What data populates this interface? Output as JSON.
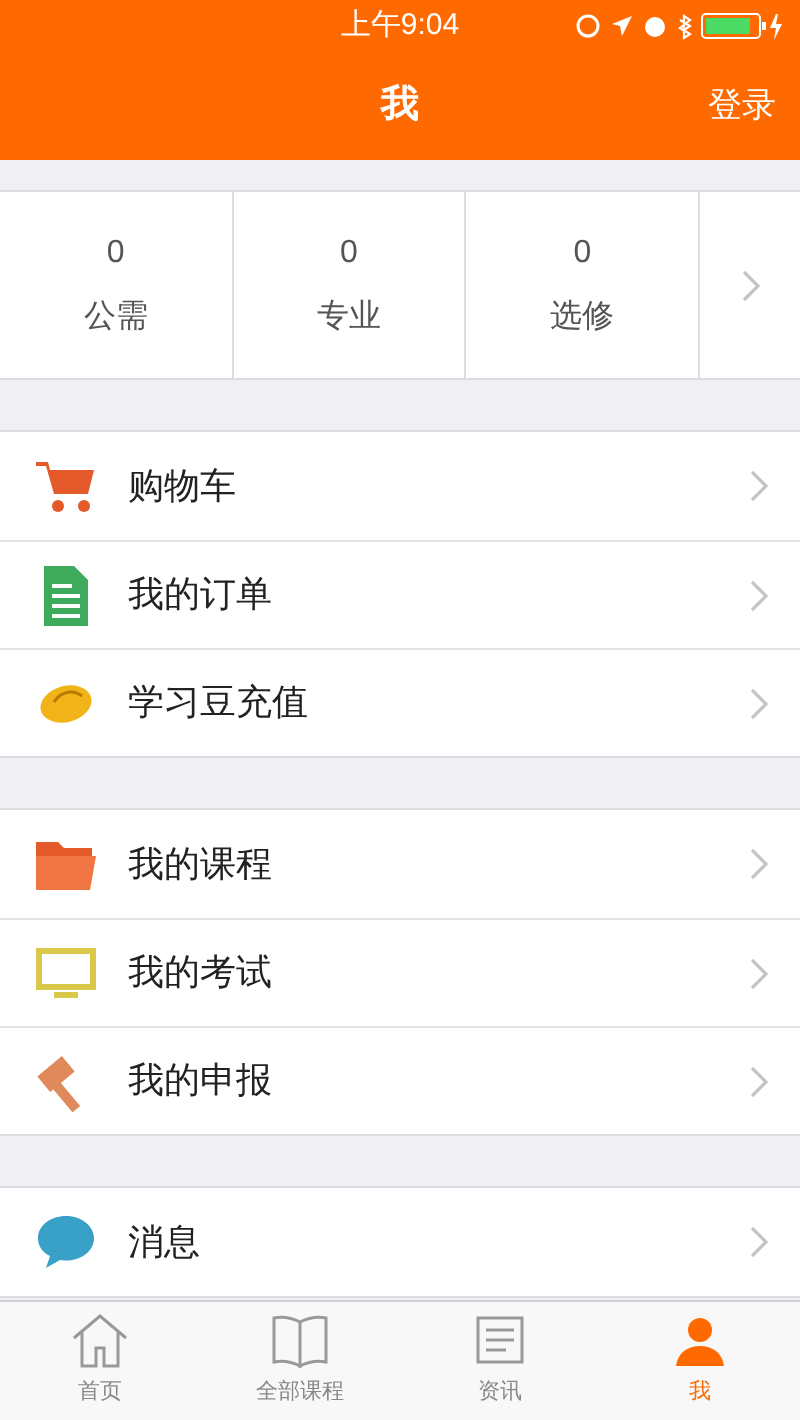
{
  "status_bar": {
    "time": "上午9:04"
  },
  "nav": {
    "title": "我",
    "action": "登录"
  },
  "stats": [
    {
      "value": "0",
      "label": "公需"
    },
    {
      "value": "0",
      "label": "专业"
    },
    {
      "value": "0",
      "label": "选修"
    }
  ],
  "menu_groups": [
    [
      {
        "kind": "cart",
        "label": "购物车"
      },
      {
        "kind": "order",
        "label": "我的订单"
      },
      {
        "kind": "bean",
        "label": "学习豆充值"
      }
    ],
    [
      {
        "kind": "folder",
        "label": "我的课程"
      },
      {
        "kind": "monitor",
        "label": "我的考试"
      },
      {
        "kind": "hammer",
        "label": "我的申报"
      }
    ],
    [
      {
        "kind": "chat",
        "label": "消息"
      }
    ]
  ],
  "tabs": [
    {
      "kind": "home",
      "label": "首页",
      "selected": false
    },
    {
      "kind": "book",
      "label": "全部课程",
      "selected": false
    },
    {
      "kind": "news",
      "label": "资讯",
      "selected": false
    },
    {
      "kind": "person",
      "label": "我",
      "selected": true
    }
  ]
}
